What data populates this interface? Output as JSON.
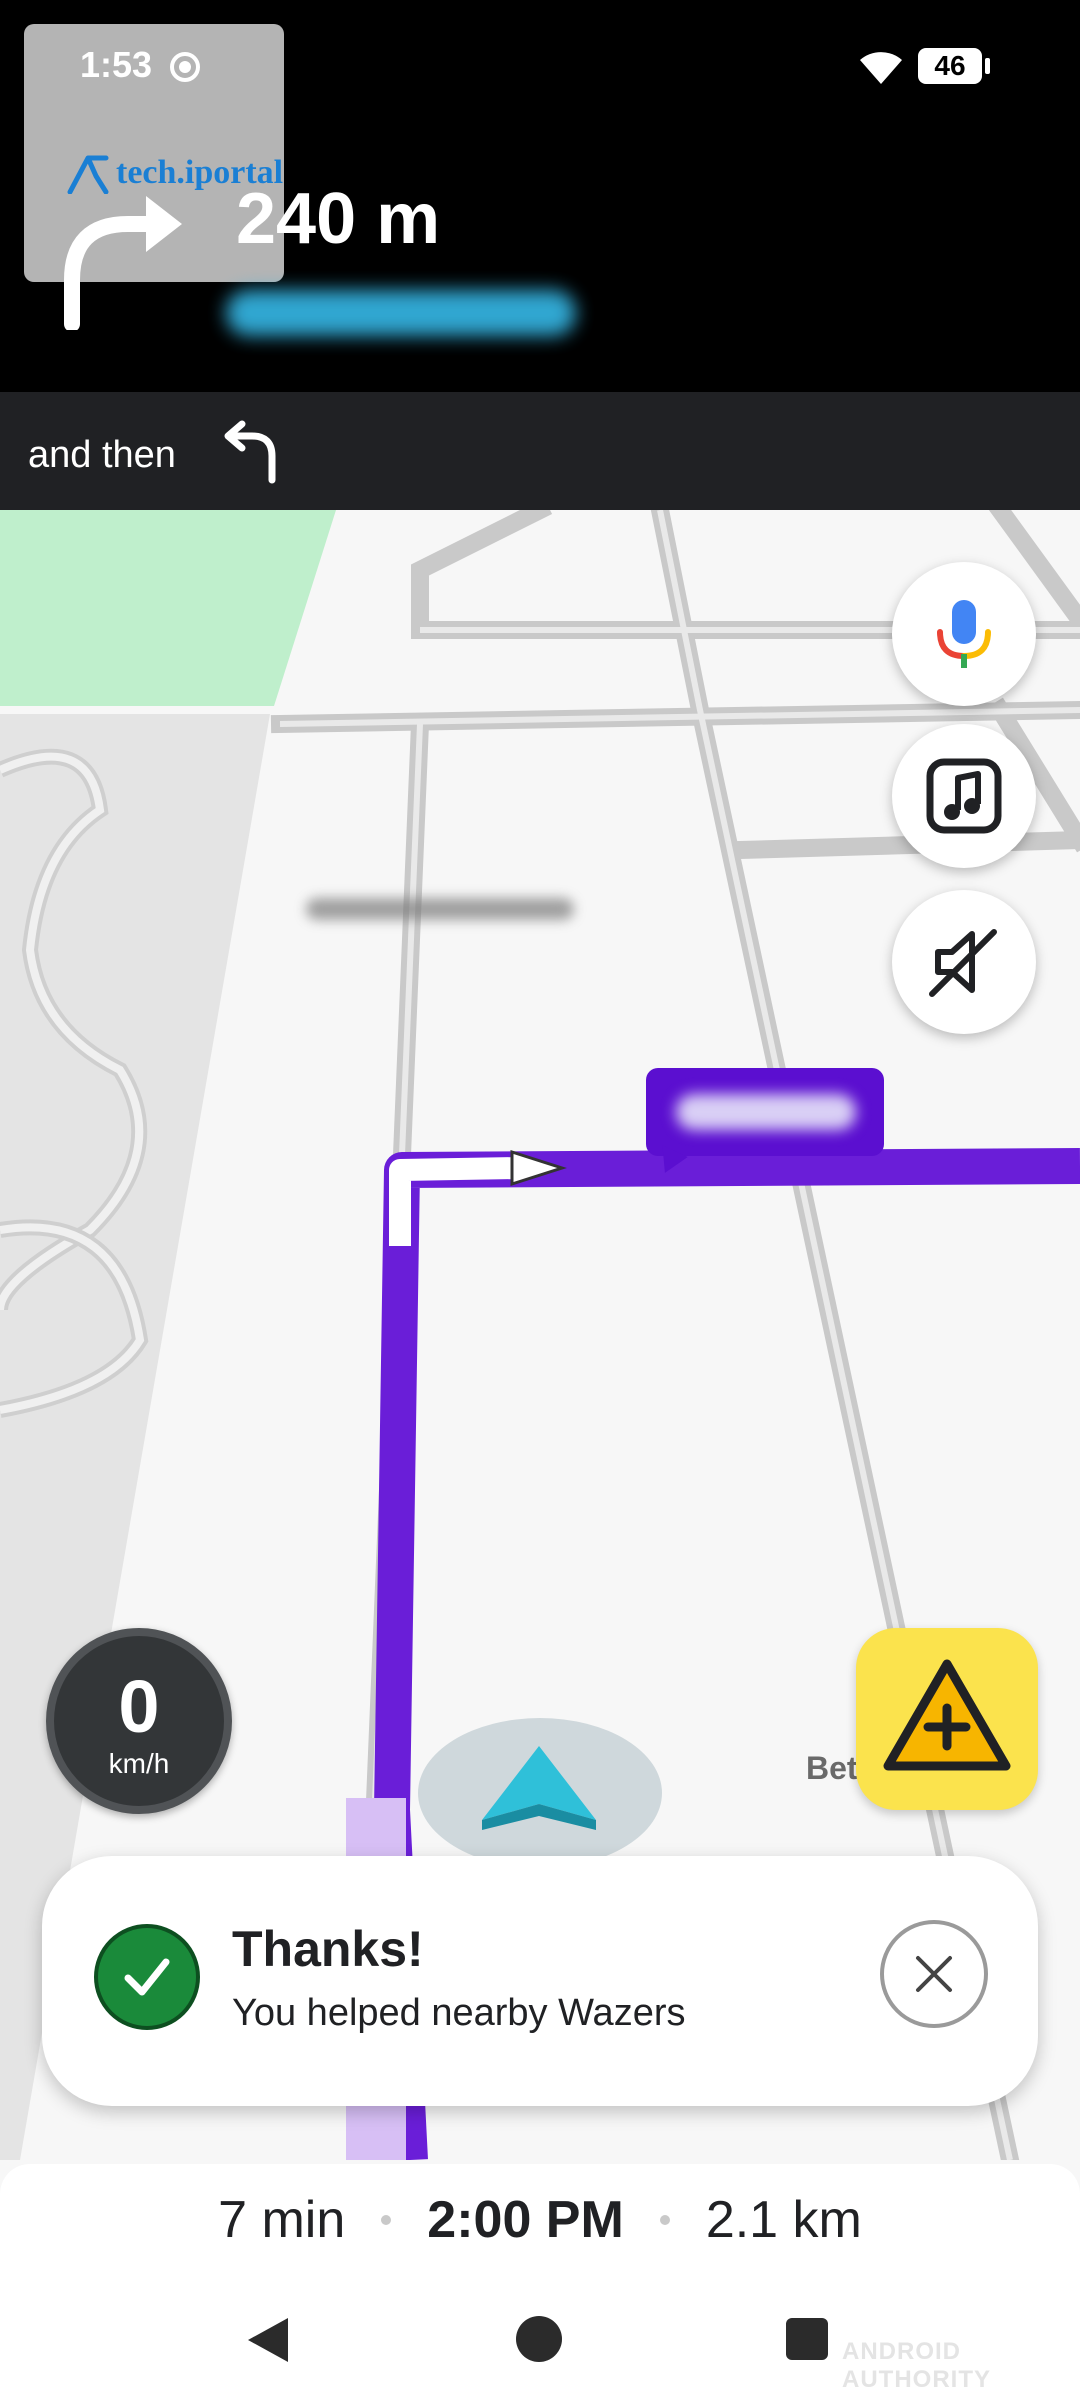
{
  "status_bar": {
    "time": "1:53",
    "battery": "46"
  },
  "navigation": {
    "logo_text": "tech.iportal",
    "turn_distance": "240 m",
    "next_label": "and then"
  },
  "map": {
    "partial_label": "Bet"
  },
  "speedometer": {
    "value": "0",
    "unit": "km/h"
  },
  "toast": {
    "title": "Thanks!",
    "message": "You helped nearby Wazers"
  },
  "eta": {
    "duration": "7 min",
    "arrival_time": "2:00 PM",
    "distance": "2.1 km"
  },
  "watermark": "ANDROID AUTHORITY",
  "colors": {
    "route": "#6a1ed8",
    "report_button": "#fbe34d",
    "success": "#1a8a3a",
    "header": "#000000"
  }
}
